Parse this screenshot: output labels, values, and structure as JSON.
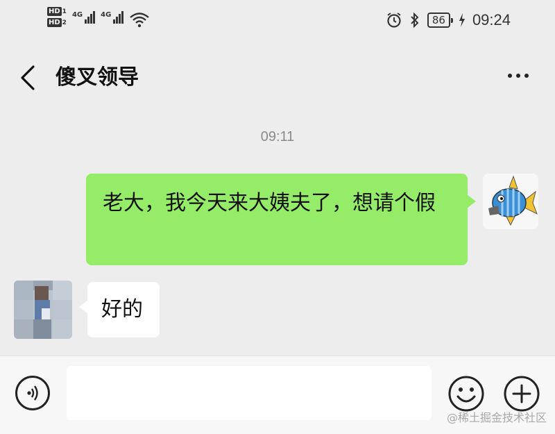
{
  "status_bar": {
    "hd1": "HD",
    "hd1_num": "1",
    "hd2": "HD",
    "hd2_num": "2",
    "net1": "4G",
    "net2": "4G",
    "battery": "86",
    "time": "09:24"
  },
  "nav": {
    "title": "傻叉领导"
  },
  "chat": {
    "timestamp": "09:11",
    "messages": [
      {
        "from": "me",
        "text": "老大，我今天来大姨夫了，想请个假"
      },
      {
        "from": "other",
        "text": "好的"
      }
    ]
  },
  "input": {
    "value": "",
    "placeholder": ""
  },
  "watermark": "@稀土掘金技术社区",
  "colors": {
    "background": "#ededed",
    "bubble_out": "#95ec69",
    "bubble_in": "#ffffff",
    "input_bar": "#f7f7f7"
  },
  "icons": [
    "hd-icon",
    "signal-icon",
    "wifi-icon",
    "alarm-icon",
    "bluetooth-icon",
    "battery-icon",
    "charging-icon",
    "back-icon",
    "more-icon",
    "voice-icon",
    "emoji-icon",
    "plus-icon"
  ]
}
